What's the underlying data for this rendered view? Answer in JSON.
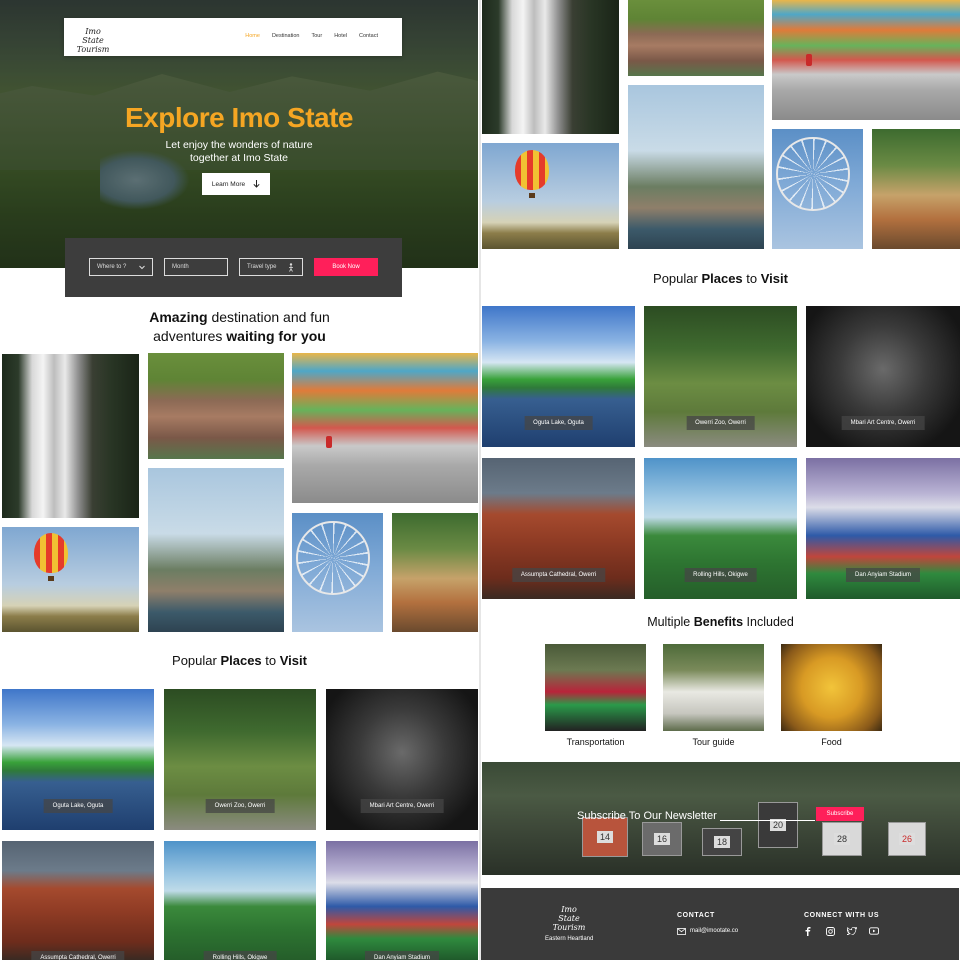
{
  "nav": {
    "logo_line1": "Imo State",
    "logo_line2": "Tourism",
    "links": [
      "Home",
      "Destination",
      "Tour",
      "Hotel",
      "Contact"
    ]
  },
  "hero": {
    "title": "Explore Imo State",
    "subtitle_line1": "Let enjoy the wonders of nature",
    "subtitle_line2": "together at Imo State",
    "cta": "Learn More"
  },
  "booking": {
    "where": "Where to ?",
    "month": "Month",
    "travel_type": "Travel type",
    "book": "Book Now"
  },
  "amazing": {
    "b1": "Amazing",
    "t1": " destination and fun",
    "t2": "adventures ",
    "b2": "waiting for you"
  },
  "popular": {
    "t1": "Popular ",
    "b1": "Places",
    "t2": " to ",
    "b2": "Visit"
  },
  "places": [
    "Oguta Lake, Oguta",
    "Owerri Zoo, Owerri",
    "Mbari Art Centre, Owerri",
    "Assumpta Cathedral, Owerri",
    "Rolling Hills, Okigwe",
    "Dan Anyiam Stadium"
  ],
  "benefits": {
    "t1": "Multiple ",
    "b1": "Benefits",
    "t2": " Included",
    "items": [
      "Transportation",
      "Tour guide",
      "Food"
    ]
  },
  "newsletter": {
    "title": "Subscribe To Our Newsletter",
    "button": "Subscribe",
    "boxes": [
      "14",
      "16",
      "18",
      "20",
      "28",
      "26"
    ]
  },
  "footer": {
    "tagline": "Eastern Heartland",
    "contact_title": "CONTACT",
    "email": "mail@imootate.co",
    "connect_title": "CONNECT WITH US"
  }
}
